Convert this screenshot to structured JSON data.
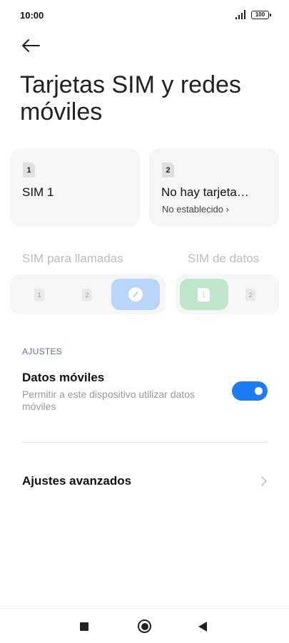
{
  "status_bar": {
    "time": "10:00",
    "battery": "100",
    "icons": [
      "signal-icon",
      "battery-icon"
    ]
  },
  "header": {
    "back_icon": "arrow-left-icon",
    "title": "Tarjetas SIM y redes móviles"
  },
  "sim_cards": [
    {
      "slot": "1",
      "name": "SIM 1",
      "status": ""
    },
    {
      "slot": "2",
      "name": "No hay tarjeta…",
      "status": "No establecido ›"
    }
  ],
  "calls_selector": {
    "label": "SIM para llamadas",
    "options": [
      "1",
      "2"
    ],
    "selected_icon": "pencil-icon",
    "accent": "#b9d5f7"
  },
  "data_selector": {
    "label": "SIM de datos",
    "selected": "1",
    "options": [
      "2"
    ],
    "accent": "#bfe6cb"
  },
  "settings": {
    "section_header": "AJUSTES",
    "mobile_data": {
      "title": "Datos móviles",
      "description": "Permitir a este dispositivo utilizar datos móviles",
      "enabled": true,
      "toggle_color": "#1c7cf4"
    },
    "advanced": {
      "title": "Ajustes avanzados",
      "icon": "chevron-right-icon"
    }
  },
  "nav_bar": {
    "icons": [
      "recents-icon",
      "home-icon",
      "back-icon"
    ]
  }
}
